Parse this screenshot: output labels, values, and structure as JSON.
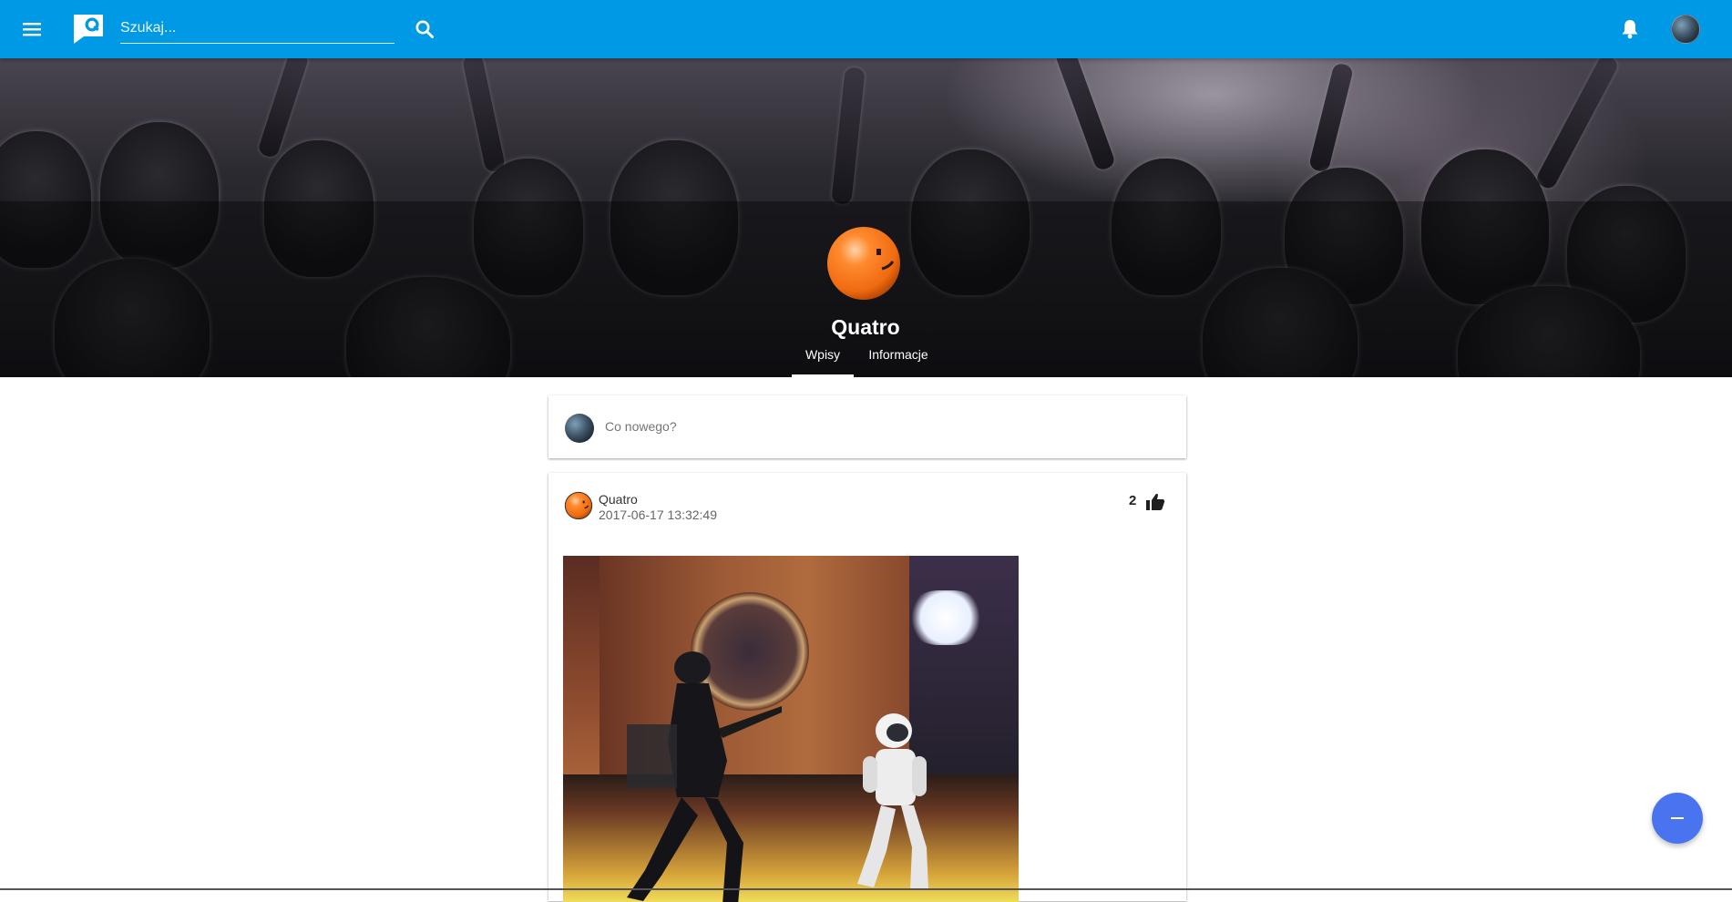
{
  "header": {
    "search": {
      "placeholder": "Szukaj..."
    }
  },
  "profile": {
    "name": "Quatro",
    "tabs": [
      {
        "label": "Wpisy",
        "active": true
      },
      {
        "label": "Informacje",
        "active": false
      }
    ]
  },
  "composer": {
    "prompt": "Co nowego?"
  },
  "post": {
    "author": "Quatro",
    "timestamp": "2017-06-17 13:32:49",
    "likes": "2"
  },
  "colors": {
    "appbar": "#0099e6",
    "fab": "#4a73f0",
    "avatar_orange": "#ff7a1a"
  },
  "icons": {
    "menu": "menu-icon",
    "logo": "logo-icon",
    "search": "search-icon",
    "notifications": "bell-icon",
    "like": "thumbs-up-icon",
    "fab": "minus-icon"
  }
}
